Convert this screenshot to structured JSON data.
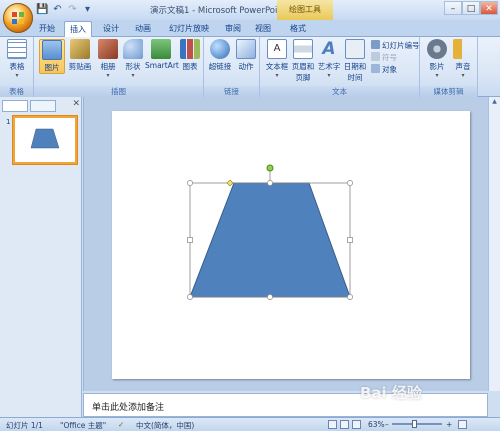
{
  "window": {
    "title": "演示文稿1 - Microsoft PowerPoint",
    "context_tab": "绘图工具",
    "buttons": [
      "–",
      "□",
      "✕"
    ]
  },
  "quick_access": {
    "icons": [
      "save-icon",
      "undo-icon",
      "redo-icon",
      "customize-icon"
    ],
    "glyphs": [
      "💾",
      "↶",
      "↷",
      "▾"
    ]
  },
  "tabs": [
    {
      "label": "开始",
      "active": false
    },
    {
      "label": "插入",
      "active": true
    },
    {
      "label": "设计",
      "active": false
    },
    {
      "label": "动画",
      "active": false
    },
    {
      "label": "幻灯片放映",
      "active": false
    },
    {
      "label": "审阅",
      "active": false
    },
    {
      "label": "视图",
      "active": false
    },
    {
      "label": "格式",
      "active": false
    }
  ],
  "ribbon": {
    "groups": {
      "tables": "表格",
      "illustrations": "插图",
      "links": "链接",
      "text": "文本",
      "media": "媒体剪辑"
    },
    "buttons": {
      "table": "表格",
      "picture": "图片",
      "clipart": "剪贴画",
      "album": "相册",
      "shapes": "形状",
      "smartart": "SmartArt",
      "chart": "图表",
      "hyperlink": "超链接",
      "action": "动作",
      "textbox": "文本框",
      "header_footer_1": "页眉和",
      "header_footer_2": "页脚",
      "wordart": "艺术字",
      "datetime_1": "日期和",
      "datetime_2": "时间",
      "slide_number": "幻灯片编号",
      "symbol": "符号",
      "object": "对象",
      "movie": "影片",
      "sound": "声音"
    },
    "colors": {
      "picture": "#6aa0d8",
      "clipart": "#c9a24a",
      "album": "#b7634a",
      "shapes": "#7aa6d8",
      "smartart": "#4b9a4b",
      "chart": "#3a73c0",
      "hyperlink": "#3f7ccc",
      "action": "#7a9ec8",
      "textbox": "#ffffff",
      "header_footer": "#cfd9e6",
      "wordart": "#5f86c0",
      "datetime": "#e8eef6",
      "movie": "#6a7a8e",
      "sound": "#e4b23a"
    }
  },
  "left_pane": {
    "slide_number": "1"
  },
  "notes": {
    "placeholder": "单击此处添加备注"
  },
  "status": {
    "slide": "幻灯片 1/1",
    "theme": "\"Office 主题\"",
    "language": "中文(简体，中国)",
    "zoom": "63%",
    "zoom_out": "–",
    "zoom_in": "+"
  },
  "slide": {
    "shape_fill": "#4f81bd",
    "shape_stroke": "#385d8a",
    "selection_color": "#888888",
    "rotate_handle_color": "#8fd14f",
    "adjust_handle_color": "#f4e36a"
  },
  "watermark": "Bai 经验"
}
